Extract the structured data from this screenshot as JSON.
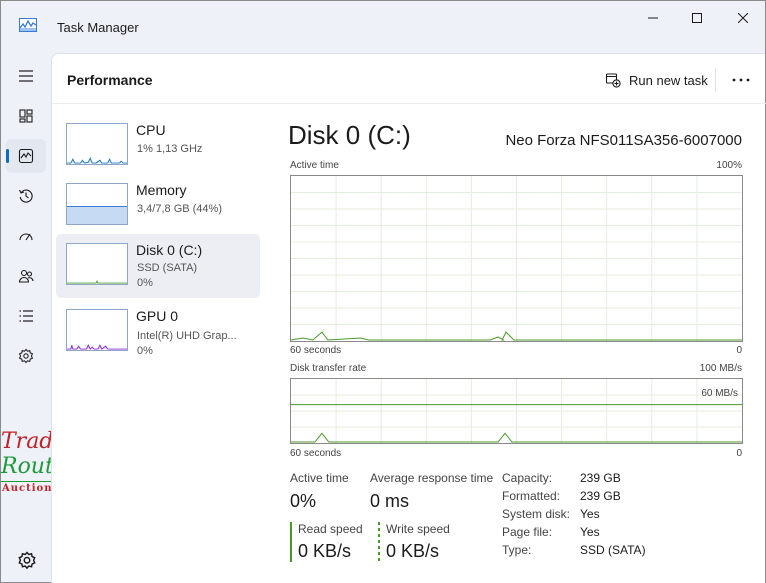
{
  "window": {
    "title": "Task Manager",
    "icon": "task-manager-app-icon",
    "controls": [
      "minimize-icon",
      "maximize-icon",
      "close-icon"
    ]
  },
  "nav": {
    "items": [
      {
        "name": "hamburger-menu-icon"
      },
      {
        "name": "processes-icon"
      },
      {
        "name": "performance-icon",
        "active": true
      },
      {
        "name": "app-history-icon"
      },
      {
        "name": "startup-apps-icon"
      },
      {
        "name": "users-icon"
      },
      {
        "name": "details-icon"
      },
      {
        "name": "services-icon"
      }
    ],
    "settings_icon": "gear-icon"
  },
  "header": {
    "title": "Performance",
    "run_new_task": "Run new task",
    "more_icon": "more-options-icon"
  },
  "devices": [
    {
      "name": "CPU",
      "line1": "1% 1,13 GHz",
      "line2": "",
      "color": "#1f7ab8"
    },
    {
      "name": "Memory",
      "line1": "3,4/7,8 GB (44%)",
      "line2": "",
      "color": "#3d7fd0",
      "usage_fraction": 0.44
    },
    {
      "name": "Disk 0 (C:)",
      "line1": "SSD (SATA)",
      "line2": "0%",
      "color": "#4a9a2a",
      "selected": true
    },
    {
      "name": "GPU 0",
      "line1": "Intel(R) UHD Grap...",
      "line2": "0%",
      "color": "#8a2be2"
    }
  ],
  "detail": {
    "title": "Disk 0 (C:)",
    "model": "Neo Forza NFS011SA356-6007000",
    "active_time_graph": {
      "label": "Active time",
      "max_label": "100%",
      "left_bottom": "60 seconds",
      "right_bottom": "0",
      "line_color": "#4a9a2a"
    },
    "transfer_graph": {
      "label": "Disk transfer rate",
      "max_label": "100 MB/s",
      "marker_label": "60 MB/s",
      "marker_value": 60,
      "max_value": 100,
      "left_bottom": "60 seconds",
      "right_bottom": "0",
      "line_color": "#4a9a2a"
    },
    "stats": {
      "active_time_label": "Active time",
      "active_time_value": "0%",
      "avg_response_label": "Average response time",
      "avg_response_value": "0 ms",
      "read_label": "Read speed",
      "read_value": "0 KB/s",
      "write_label": "Write speed",
      "write_value": "0 KB/s"
    },
    "properties": [
      {
        "label": "Capacity:",
        "value": "239 GB"
      },
      {
        "label": "Formatted:",
        "value": "239 GB"
      },
      {
        "label": "System disk:",
        "value": "Yes"
      },
      {
        "label": "Page file:",
        "value": "Yes"
      },
      {
        "label": "Type:",
        "value": "SSD (SATA)"
      }
    ]
  },
  "watermark": {
    "line1": "Trade",
    "line2": "Route",
    "line3": "Auctions"
  }
}
